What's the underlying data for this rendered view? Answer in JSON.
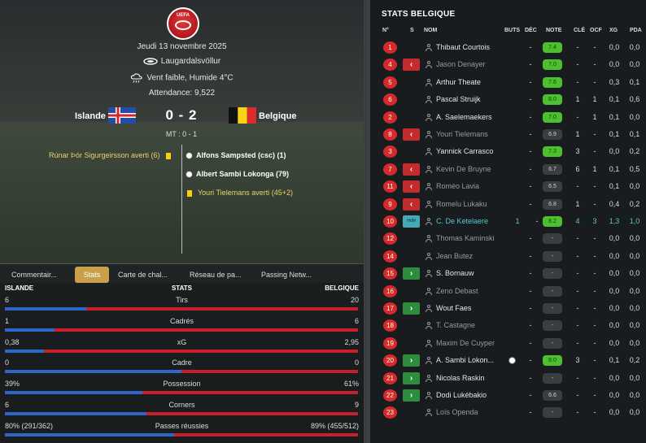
{
  "match": {
    "logo_text": "UEFA",
    "date": "Jeudi 13 novembre 2025",
    "stadium": "Laugardalsvöllur",
    "weather": "Vent faible, Humide 4°C",
    "attendance": "Attendance:  9,522",
    "home_team": "Islande",
    "away_team": "Belgique",
    "score": "0 - 2",
    "half_time": "MT : 0 - 1"
  },
  "events": {
    "home": [
      {
        "text": "Rúnar Þór Sigurgeirsson averti (6)",
        "type": "yellow"
      }
    ],
    "away": [
      {
        "text": "Alfons Sampsted (csc) (1)",
        "type": "goal"
      },
      {
        "text": "Albert Sambi Lokonga (79)",
        "type": "goal"
      },
      {
        "text": "Youri Tielemans averti (45+2)",
        "type": "yellow"
      }
    ]
  },
  "tabs": [
    "Commentair...",
    "Stats",
    "Carte de chal...",
    "Réseau de pa...",
    "Passing Netw..."
  ],
  "stats": {
    "home_label": "ISLANDE",
    "center_label": "STATS",
    "away_label": "BELGIQUE",
    "rows": [
      {
        "label": "Tirs",
        "home": "6",
        "away": "20",
        "home_share": 0.23
      },
      {
        "label": "Cadrés",
        "home": "1",
        "away": "6",
        "home_share": 0.14
      },
      {
        "label": "xG",
        "home": "0,38",
        "away": "2,95",
        "home_share": 0.11
      },
      {
        "label": "Cadre",
        "home": "0",
        "away": "0",
        "home_share": 0.5
      },
      {
        "label": "Possession",
        "home": "39%",
        "away": "61%",
        "home_share": 0.39
      },
      {
        "label": "Corners",
        "home": "6",
        "away": "9",
        "home_share": 0.4
      },
      {
        "label": "Passes réussies",
        "home": "80% (291/362)",
        "away": "89% (455/512)",
        "home_share": 0.48
      }
    ]
  },
  "belgique": {
    "title": "STATS BELGIQUE",
    "columns": [
      "N°",
      "S",
      "NOM",
      "BUTS",
      "DÉC",
      "NOTE",
      "CLÉ",
      "OCF",
      "XG",
      "PDA"
    ],
    "players": [
      {
        "num": "1",
        "sub": "",
        "name": "Thibaut Courtois",
        "style": "starter",
        "buts": "",
        "dec": "-",
        "note": "7.4",
        "note_style": "green",
        "cle": "-",
        "ocf": "-",
        "xg": "0,0",
        "pda": "0,0",
        "goal": false
      },
      {
        "num": "4",
        "sub": "out",
        "name": "Jason Denayer",
        "style": "bench",
        "buts": "",
        "dec": "-",
        "note": "7.0",
        "note_style": "green",
        "cle": "-",
        "ocf": "-",
        "xg": "0,0",
        "pda": "0,0",
        "goal": false
      },
      {
        "num": "5",
        "sub": "",
        "name": "Arthur Theate",
        "style": "starter",
        "buts": "",
        "dec": "-",
        "note": "7.6",
        "note_style": "green",
        "cle": "-",
        "ocf": "-",
        "xg": "0,3",
        "pda": "0,1",
        "goal": false
      },
      {
        "num": "6",
        "sub": "",
        "name": "Pascal Struijk",
        "style": "starter",
        "buts": "",
        "dec": "-",
        "note": "8.0",
        "note_style": "green",
        "cle": "1",
        "ocf": "1",
        "xg": "0,1",
        "pda": "0,6",
        "goal": false
      },
      {
        "num": "2",
        "sub": "",
        "name": "A. Saelemaekers",
        "style": "starter",
        "buts": "",
        "dec": "-",
        "note": "7.0",
        "note_style": "green",
        "cle": "-",
        "ocf": "1",
        "xg": "0,1",
        "pda": "0,0",
        "goal": false
      },
      {
        "num": "8",
        "sub": "out",
        "name": "Youri Tielemans",
        "style": "bench",
        "buts": "",
        "dec": "-",
        "note": "6.9",
        "note_style": "gray",
        "cle": "1",
        "ocf": "-",
        "xg": "0,1",
        "pda": "0,1",
        "goal": false
      },
      {
        "num": "3",
        "sub": "",
        "name": "Yannick Carrasco",
        "style": "starter",
        "buts": "",
        "dec": "-",
        "note": "7.3",
        "note_style": "green",
        "cle": "3",
        "ocf": "-",
        "xg": "0,0",
        "pda": "0,2",
        "goal": false
      },
      {
        "num": "7",
        "sub": "out",
        "name": "Kevin De Bruyne",
        "style": "bench",
        "buts": "",
        "dec": "-",
        "note": "6.7",
        "note_style": "gray",
        "cle": "6",
        "ocf": "1",
        "xg": "0,1",
        "pda": "0,5",
        "goal": false
      },
      {
        "num": "11",
        "sub": "out",
        "name": "Roméo Lavia",
        "style": "bench",
        "buts": "",
        "dec": "-",
        "note": "6.5",
        "note_style": "gray",
        "cle": "-",
        "ocf": "-",
        "xg": "0,1",
        "pda": "0,0",
        "goal": false
      },
      {
        "num": "9",
        "sub": "out",
        "name": "Romelu Lukaku",
        "style": "bench",
        "buts": "",
        "dec": "-",
        "note": "6.8",
        "note_style": "gray",
        "cle": "1",
        "ocf": "-",
        "xg": "0,4",
        "pda": "0,2",
        "goal": false
      },
      {
        "num": "10",
        "sub": "hdm",
        "sub_label": "HdM",
        "name": "C. De Ketelaere",
        "style": "star",
        "buts": "1",
        "dec": "-",
        "note": "8.2",
        "note_style": "green",
        "cle": "4",
        "ocf": "3",
        "xg": "1,3",
        "pda": "1,0",
        "goal": false
      },
      {
        "num": "12",
        "sub": "",
        "name": "Thomas Kaminski",
        "style": "bench",
        "buts": "",
        "dec": "-",
        "note": "-",
        "note_style": "gray",
        "cle": "-",
        "ocf": "-",
        "xg": "0,0",
        "pda": "0,0",
        "goal": false
      },
      {
        "num": "14",
        "sub": "",
        "name": "Jean Butez",
        "style": "bench",
        "buts": "",
        "dec": "-",
        "note": "-",
        "note_style": "gray",
        "cle": "-",
        "ocf": "-",
        "xg": "0,0",
        "pda": "0,0",
        "goal": false
      },
      {
        "num": "15",
        "sub": "in",
        "name": "S. Bornauw",
        "style": "starter",
        "buts": "",
        "dec": "-",
        "note": "-",
        "note_style": "gray",
        "cle": "-",
        "ocf": "-",
        "xg": "0,0",
        "pda": "0,0",
        "goal": false
      },
      {
        "num": "16",
        "sub": "",
        "name": "Zeno Debast",
        "style": "bench",
        "buts": "",
        "dec": "-",
        "note": "-",
        "note_style": "gray",
        "cle": "-",
        "ocf": "-",
        "xg": "0,0",
        "pda": "0,0",
        "goal": false
      },
      {
        "num": "17",
        "sub": "in",
        "name": "Wout Faes",
        "style": "starter",
        "buts": "",
        "dec": "-",
        "note": "-",
        "note_style": "gray",
        "cle": "-",
        "ocf": "-",
        "xg": "0,0",
        "pda": "0,0",
        "goal": false
      },
      {
        "num": "18",
        "sub": "",
        "name": "T. Castagne",
        "style": "bench",
        "buts": "",
        "dec": "-",
        "note": "-",
        "note_style": "gray",
        "cle": "-",
        "ocf": "-",
        "xg": "0,0",
        "pda": "0,0",
        "goal": false
      },
      {
        "num": "19",
        "sub": "",
        "name": "Maxim De Cuyper",
        "style": "bench",
        "buts": "",
        "dec": "-",
        "note": "-",
        "note_style": "gray",
        "cle": "-",
        "ocf": "-",
        "xg": "0,0",
        "pda": "0,0",
        "goal": false
      },
      {
        "num": "20",
        "sub": "in",
        "name": "A. Sambi Lokon...",
        "style": "starter",
        "buts": "",
        "dec": "-",
        "note": "8.0",
        "note_style": "green",
        "cle": "3",
        "ocf": "-",
        "xg": "0,1",
        "pda": "0,2",
        "goal": true
      },
      {
        "num": "21",
        "sub": "in",
        "name": "Nicolas Raskin",
        "style": "starter",
        "buts": "",
        "dec": "-",
        "note": "-",
        "note_style": "gray",
        "cle": "-",
        "ocf": "-",
        "xg": "0,0",
        "pda": "0,0",
        "goal": false
      },
      {
        "num": "22",
        "sub": "in",
        "name": "Dodi Lukébakio",
        "style": "starter",
        "buts": "",
        "dec": "-",
        "note": "6.6",
        "note_style": "gray",
        "cle": "-",
        "ocf": "-",
        "xg": "0,0",
        "pda": "0,0",
        "goal": false
      },
      {
        "num": "23",
        "sub": "",
        "name": "Loïs Openda",
        "style": "bench",
        "buts": "",
        "dec": "-",
        "note": "-",
        "note_style": "gray",
        "cle": "-",
        "ocf": "-",
        "xg": "0,0",
        "pda": "0,0",
        "goal": false
      }
    ]
  },
  "colors": {
    "home_bar": "#2f67c9",
    "away_bar": "#c91f2c",
    "tab_active": "#c8a04a",
    "rating_green": "#4cc02f",
    "number_badge": "#d52a2a"
  }
}
